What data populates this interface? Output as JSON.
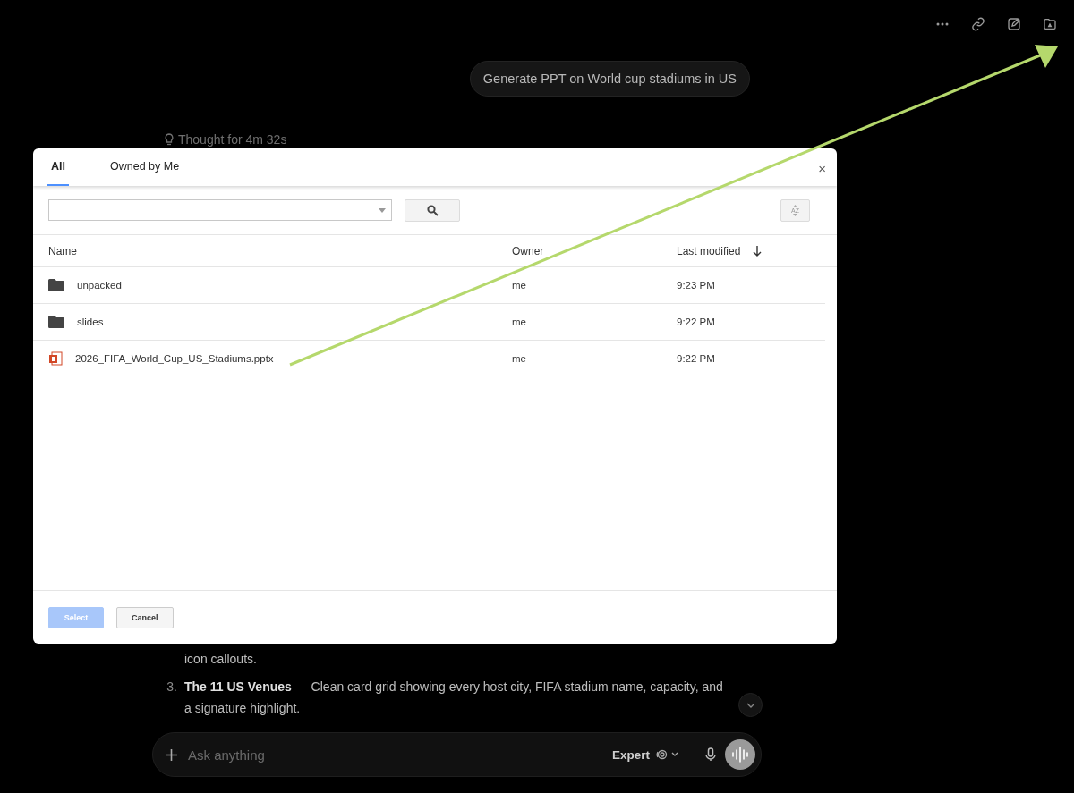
{
  "prompt_bubble": "Generate PPT on World cup stadiums in US",
  "thought": "Thought for 4m 32s",
  "answer": [
    {
      "text": "icon callouts."
    },
    {
      "number": "3.",
      "text": "**The 11 US Venues** — Clean card grid showing every host city, FIFA stadium name, capacity, and a signature highlight."
    }
  ],
  "composer": {
    "placeholder": "Ask anything",
    "mode": "Expert"
  },
  "dialog": {
    "tabs": [
      {
        "label": "All",
        "selected": true
      },
      {
        "label": "Owned by Me",
        "selected": false
      }
    ],
    "close": "×",
    "sort_label": "AZ",
    "columns": [
      "Name",
      "Owner",
      "Last modified"
    ],
    "rows": [
      {
        "kind": "folder",
        "name": "unpacked",
        "owner": "me",
        "modified": "9:23 PM"
      },
      {
        "kind": "folder",
        "name": "slides",
        "owner": "me",
        "modified": "9:22 PM"
      },
      {
        "kind": "pptx",
        "name": "2026_FIFA_World_Cup_US_Stadiums.pptx",
        "owner": "me",
        "modified": "9:22 PM"
      }
    ],
    "select": {
      "label": "Select",
      "disabled": true
    },
    "cancel": "Cancel"
  }
}
